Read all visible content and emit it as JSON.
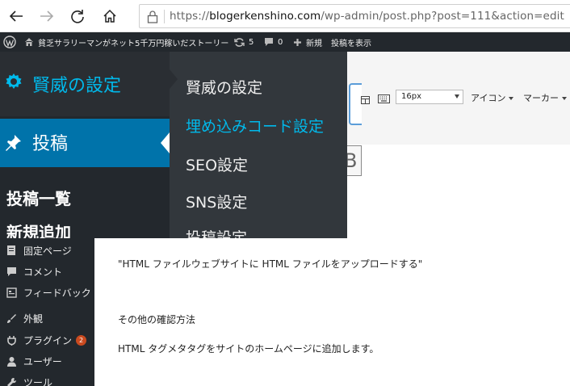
{
  "browser": {
    "url_prefix": "https://",
    "url_domain": "blogerkenshino.com",
    "url_path": "/wp-admin/post.php?post=111&action=edit"
  },
  "admin_bar": {
    "site_name": "貧乏サラリーマンがネット5千万円稼いだストーリー",
    "updates_count": "5",
    "comments_count": "0",
    "new_label": "新規",
    "view_post_label": "投稿を表示"
  },
  "flyout": {
    "settings_label": "賢威の設定",
    "posts_label": "投稿",
    "sub_all_posts": "投稿一覧",
    "sub_add_new": "新規追加",
    "panel_items": [
      "賢威の設定",
      "埋め込みコード設定",
      "SEO設定",
      "SNS設定",
      "投稿設定"
    ]
  },
  "sidebar": {
    "items": [
      {
        "label": "固定ページ",
        "icon": "page-icon"
      },
      {
        "label": "コメント",
        "icon": "comment-icon"
      },
      {
        "label": "フィードバック",
        "icon": "feedback-icon"
      },
      {
        "label": "外観",
        "icon": "appearance-icon"
      },
      {
        "label": "プラグイン",
        "icon": "plugin-icon",
        "badge": "2"
      },
      {
        "label": "ユーザー",
        "icon": "user-icon"
      },
      {
        "label": "ツール",
        "icon": "tools-icon"
      }
    ]
  },
  "toolbar": {
    "font_size": "16px",
    "icon_dropdown": "アイコン",
    "marker_dropdown": "マーカー",
    "partial_button": "B"
  },
  "content": {
    "line1": "\"HTML ファイルウェブサイトに HTML ファイルをアップロードする\"",
    "line2": "その他の確認方法",
    "line3": "HTML タグメタタグをサイトのホームページに追加します。"
  },
  "colors": {
    "admin_dark": "#23282d",
    "accent_blue": "#0073aa",
    "highlight_cyan": "#00b9eb",
    "badge_red": "#ca4a1f"
  }
}
